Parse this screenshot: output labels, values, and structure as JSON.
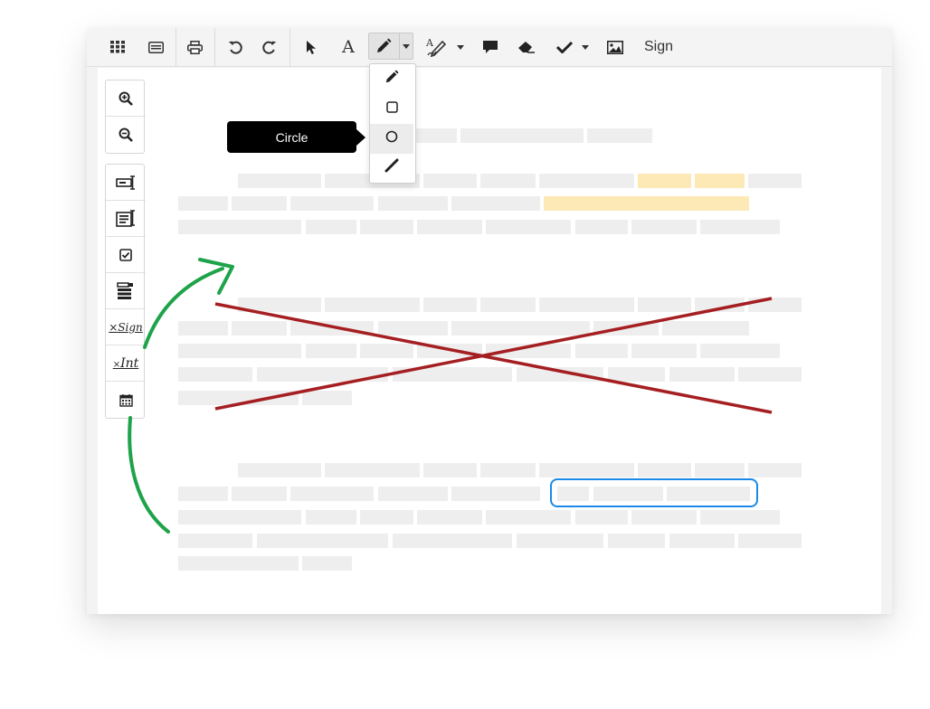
{
  "toolbar": {
    "tools": [
      {
        "name": "apps-grid-icon"
      },
      {
        "name": "panel-toggle-icon"
      },
      {
        "name": "print-icon"
      },
      {
        "name": "undo-icon"
      },
      {
        "name": "redo-icon"
      },
      {
        "name": "select-pointer-icon"
      },
      {
        "name": "text-tool-icon"
      },
      {
        "name": "pencil-icon",
        "active": true
      },
      {
        "name": "signature-pen-icon"
      },
      {
        "name": "comment-icon"
      },
      {
        "name": "eraser-icon"
      },
      {
        "name": "checkmark-icon"
      },
      {
        "name": "image-icon"
      }
    ],
    "text_tool_label": "A",
    "sign_label": "Sign"
  },
  "draw_menu": {
    "items": [
      {
        "name": "freehand",
        "icon": "pencil-icon"
      },
      {
        "name": "rectangle",
        "icon": "square-icon"
      },
      {
        "name": "circle",
        "icon": "circle-icon",
        "highlighted": true
      },
      {
        "name": "line",
        "icon": "line-icon"
      }
    ],
    "tooltip": "Circle"
  },
  "sidebar": {
    "zoom": [
      {
        "name": "zoom-in-icon"
      },
      {
        "name": "zoom-out-icon"
      }
    ],
    "fields": [
      {
        "name": "text-field-icon"
      },
      {
        "name": "text-area-icon"
      },
      {
        "name": "checkbox-icon"
      },
      {
        "name": "dropdown-field-icon"
      },
      {
        "name": "signature-field",
        "label": "Sign",
        "prefix": "×"
      },
      {
        "name": "initials-field",
        "label": "Int",
        "prefix": "×"
      },
      {
        "name": "date-field-icon"
      }
    ]
  },
  "colors": {
    "toolbar_bg": "#f4f4f4",
    "highlight": "#fde9b6",
    "placeholder_text": "#eeeeee",
    "strike_red": "#a51f22",
    "arrow_green": "#1ea34a",
    "box_blue": "#1a8ae6",
    "tooltip_bg": "#000000"
  }
}
